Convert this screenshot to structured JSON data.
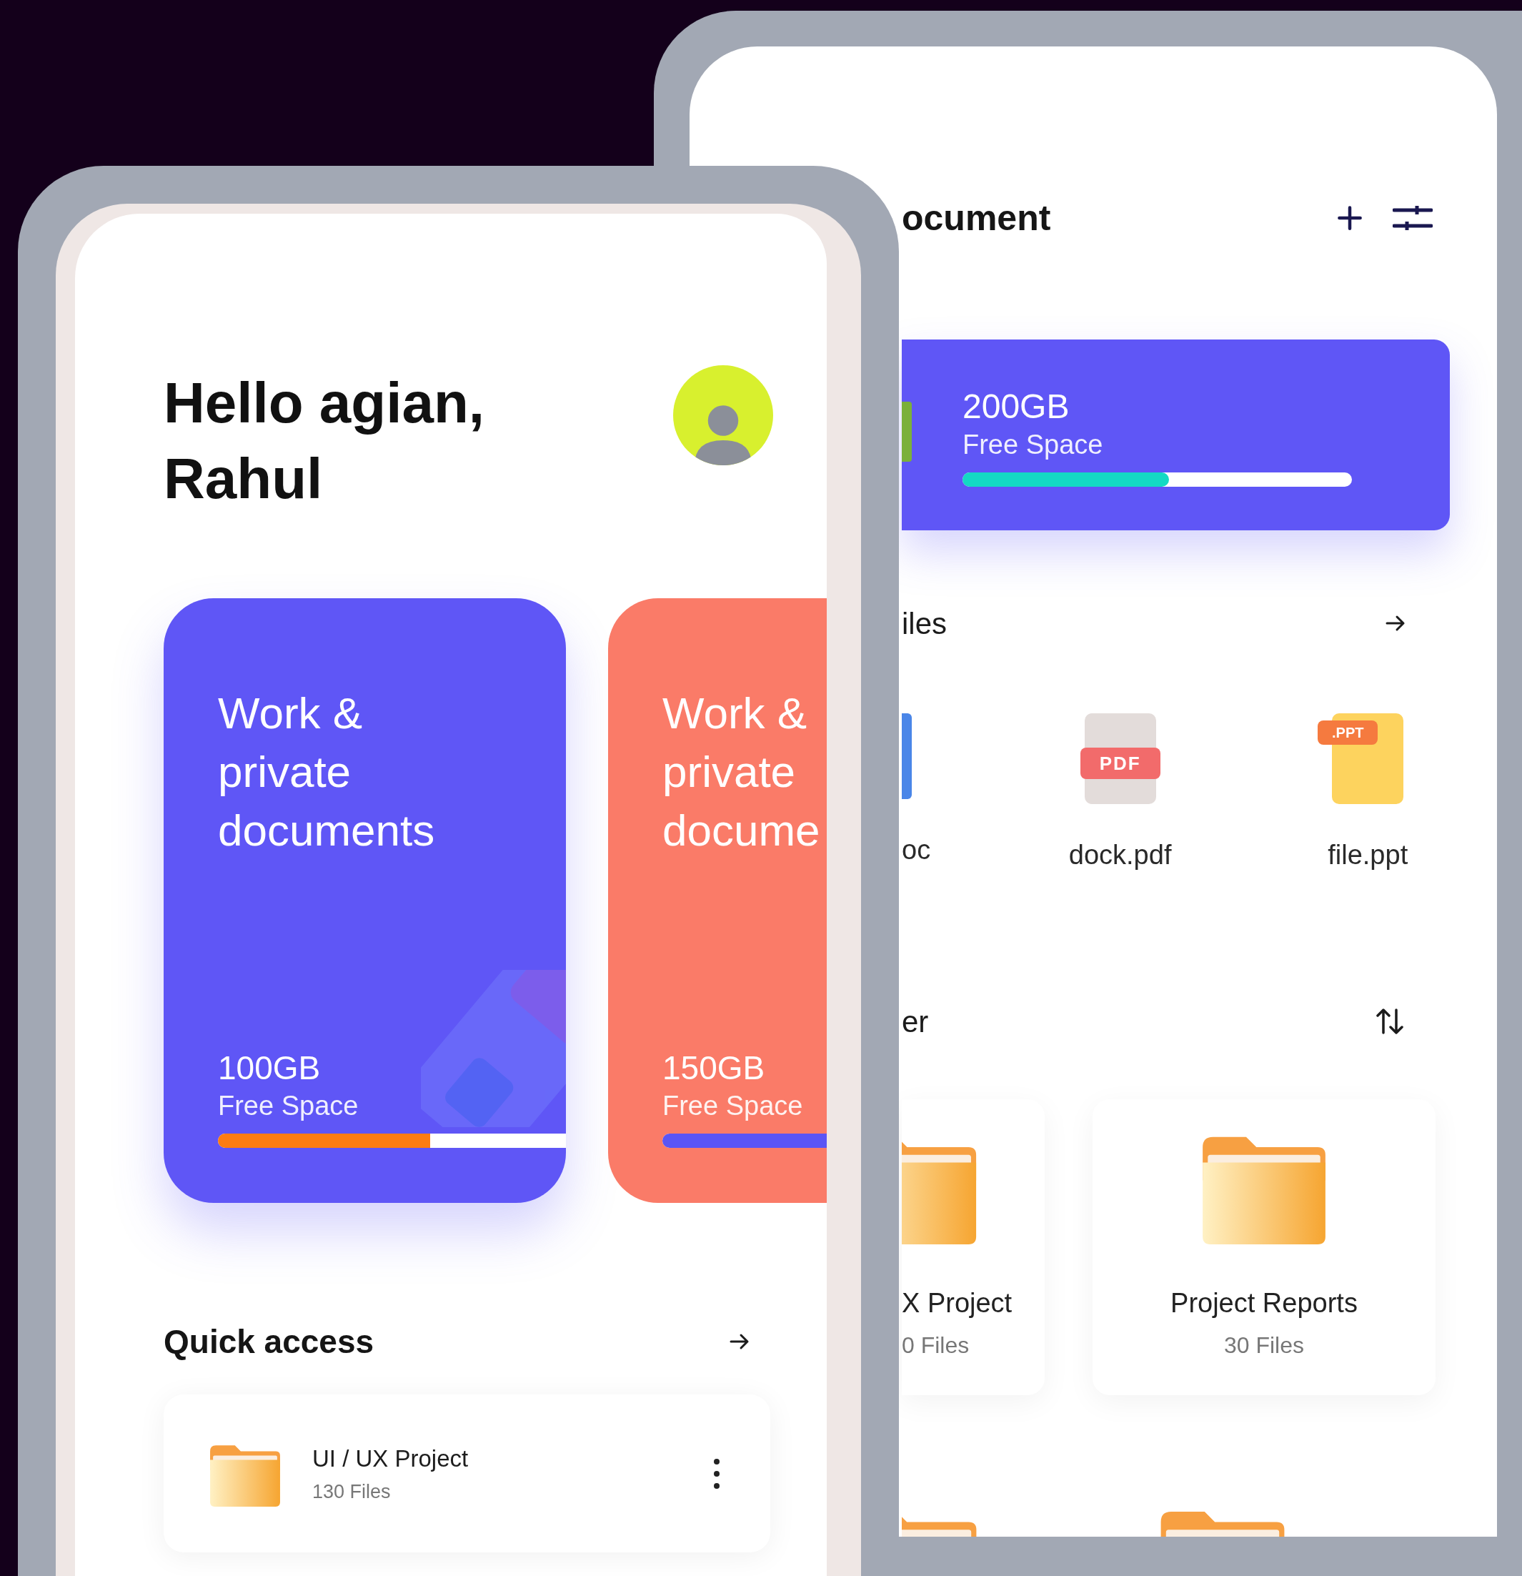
{
  "back_screen": {
    "title": "ocument",
    "storage": {
      "size": "200GB",
      "label": "Free Space",
      "level": 0.53
    },
    "recent_files": {
      "heading": "iles",
      "items": [
        {
          "name": "oc",
          "kind": "doc"
        },
        {
          "name": "dock.pdf",
          "kind": "pdf",
          "badge": "PDF"
        },
        {
          "name": "file.ppt",
          "kind": "ppt",
          "badge": ".PPT"
        }
      ]
    },
    "folders": {
      "heading": "er",
      "items": [
        {
          "name": "X Project",
          "count": "0 Files"
        },
        {
          "name": "Project Reports",
          "count": "30 Files"
        }
      ]
    }
  },
  "front_screen": {
    "greeting": [
      "Hello agian,",
      "Rahul"
    ],
    "cards": [
      {
        "title_lines": [
          "Work &",
          "private",
          "documents"
        ],
        "size": "100GB",
        "label": "Free Space",
        "level": 0.61,
        "color": "#5f56f6"
      },
      {
        "title_lines": [
          "Work &",
          "private",
          "docume"
        ],
        "size": "150GB",
        "label": "Free Space",
        "level": 1,
        "color": "#fa7b68"
      }
    ],
    "quick_access": {
      "heading": "Quick access",
      "items": [
        {
          "name": "UI / UX Project",
          "count": "130 Files"
        }
      ]
    }
  }
}
